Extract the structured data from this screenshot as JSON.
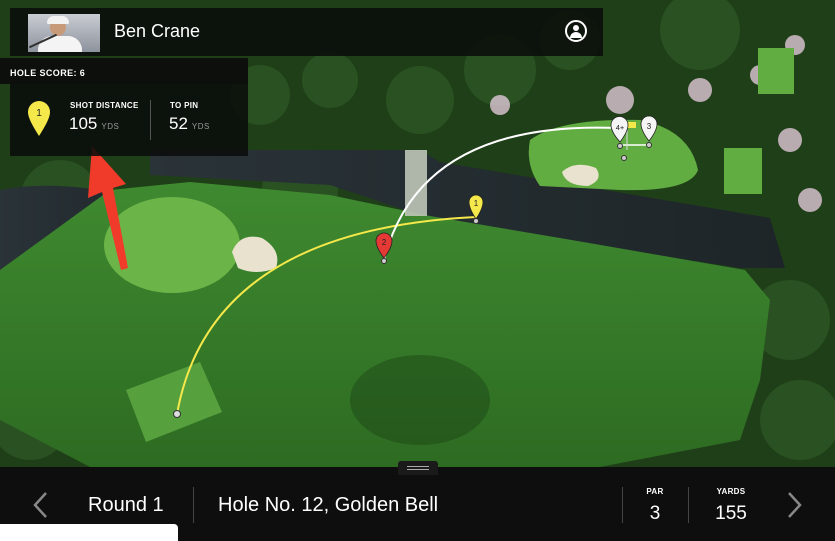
{
  "player": {
    "name": "Ben Crane"
  },
  "stats": {
    "hole_score_label": "HOLE SCORE: 6",
    "marker_number": "1",
    "shot_distance_label": "SHOT DISTANCE",
    "shot_distance_value": "105",
    "shot_distance_unit": "YDS",
    "to_pin_label": "TO PIN",
    "to_pin_value": "52",
    "to_pin_unit": "YDS"
  },
  "map_markers": {
    "shot1": "1",
    "shot2": "2",
    "shot3": "3",
    "shot4": "4+"
  },
  "footer": {
    "round": "Round 1",
    "hole": "Hole No. 12, Golden Bell",
    "par_label": "PAR",
    "par_value": "3",
    "yards_label": "YARDS",
    "yards_value": "155"
  },
  "colors": {
    "accent_yellow": "#f4e84a",
    "marker_red": "#e53935",
    "arrow_red": "#f03a2a",
    "panel_bg": "#0d0f0d"
  },
  "icons": [
    "profile-icon",
    "chevron-left-icon",
    "chevron-right-icon",
    "drag-handle-icon",
    "pin-marker-icon"
  ]
}
